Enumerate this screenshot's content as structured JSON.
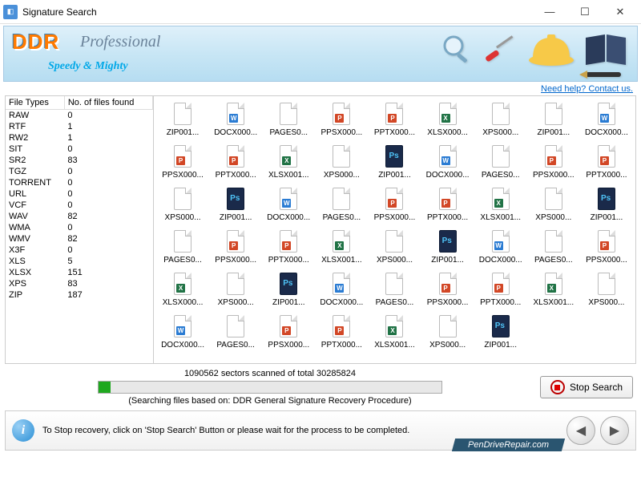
{
  "window": {
    "title": "Signature Search"
  },
  "banner": {
    "ddr": "DDR",
    "prof": "Professional",
    "tag": "Speedy & Mighty"
  },
  "help_link": "Need help? Contact us.",
  "table": {
    "col1": "File Types",
    "col2": "No. of files found",
    "rows": [
      {
        "t": "RAW",
        "n": "0"
      },
      {
        "t": "RTF",
        "n": "1"
      },
      {
        "t": "RW2",
        "n": "1"
      },
      {
        "t": "SIT",
        "n": "0"
      },
      {
        "t": "SR2",
        "n": "83"
      },
      {
        "t": "TGZ",
        "n": "0"
      },
      {
        "t": "TORRENT",
        "n": "0"
      },
      {
        "t": "URL",
        "n": "0"
      },
      {
        "t": "VCF",
        "n": "0"
      },
      {
        "t": "WAV",
        "n": "82"
      },
      {
        "t": "WMA",
        "n": "0"
      },
      {
        "t": "WMV",
        "n": "82"
      },
      {
        "t": "X3F",
        "n": "0"
      },
      {
        "t": "XLS",
        "n": "5"
      },
      {
        "t": "XLSX",
        "n": "151"
      },
      {
        "t": "XPS",
        "n": "83"
      },
      {
        "t": "ZIP",
        "n": "187"
      }
    ]
  },
  "files": [
    {
      "l": "ZIP001...",
      "k": "plain"
    },
    {
      "l": "DOCX000...",
      "k": "doc"
    },
    {
      "l": "PAGES0...",
      "k": "plain"
    },
    {
      "l": "PPSX000...",
      "k": "ppt"
    },
    {
      "l": "PPTX000...",
      "k": "ppt"
    },
    {
      "l": "XLSX000...",
      "k": "xls"
    },
    {
      "l": "XPS000...",
      "k": "plain"
    },
    {
      "l": "ZIP001...",
      "k": "plain"
    },
    {
      "l": "DOCX000...",
      "k": "doc"
    },
    {
      "l": "PPSX000...",
      "k": "ppt"
    },
    {
      "l": "PPTX000...",
      "k": "ppt"
    },
    {
      "l": "XLSX001...",
      "k": "xls"
    },
    {
      "l": "XPS000...",
      "k": "plain"
    },
    {
      "l": "ZIP001...",
      "k": "ps"
    },
    {
      "l": "DOCX000...",
      "k": "doc"
    },
    {
      "l": "PAGES0...",
      "k": "plain"
    },
    {
      "l": "PPSX000...",
      "k": "ppt"
    },
    {
      "l": "PPTX000...",
      "k": "ppt"
    },
    {
      "l": "XPS000...",
      "k": "plain"
    },
    {
      "l": "ZIP001...",
      "k": "ps"
    },
    {
      "l": "DOCX000...",
      "k": "doc"
    },
    {
      "l": "PAGES0...",
      "k": "plain"
    },
    {
      "l": "PPSX000...",
      "k": "ppt"
    },
    {
      "l": "PPTX000...",
      "k": "ppt"
    },
    {
      "l": "XLSX001...",
      "k": "xls"
    },
    {
      "l": "XPS000...",
      "k": "plain"
    },
    {
      "l": "ZIP001...",
      "k": "ps"
    },
    {
      "l": "PAGES0...",
      "k": "plain"
    },
    {
      "l": "PPSX000...",
      "k": "ppt"
    },
    {
      "l": "PPTX000...",
      "k": "ppt"
    },
    {
      "l": "XLSX001...",
      "k": "xls"
    },
    {
      "l": "XPS000...",
      "k": "plain"
    },
    {
      "l": "ZIP001...",
      "k": "ps"
    },
    {
      "l": "DOCX000...",
      "k": "doc"
    },
    {
      "l": "PAGES0...",
      "k": "plain"
    },
    {
      "l": "PPSX000...",
      "k": "ppt"
    },
    {
      "l": "XLSX000...",
      "k": "xls"
    },
    {
      "l": "XPS000...",
      "k": "plain"
    },
    {
      "l": "ZIP001...",
      "k": "ps"
    },
    {
      "l": "DOCX000...",
      "k": "doc"
    },
    {
      "l": "PAGES0...",
      "k": "plain"
    },
    {
      "l": "PPSX000...",
      "k": "ppt"
    },
    {
      "l": "PPTX000...",
      "k": "ppt"
    },
    {
      "l": "XLSX001...",
      "k": "xls"
    },
    {
      "l": "XPS000...",
      "k": "plain"
    },
    {
      "l": "DOCX000...",
      "k": "doc"
    },
    {
      "l": "PAGES0...",
      "k": "plain"
    },
    {
      "l": "PPSX000...",
      "k": "ppt"
    },
    {
      "l": "PPTX000...",
      "k": "ppt"
    },
    {
      "l": "XLSX001...",
      "k": "xls"
    },
    {
      "l": "XPS000...",
      "k": "plain"
    },
    {
      "l": "ZIP001...",
      "k": "ps"
    },
    {
      "l": "",
      "k": ""
    },
    {
      "l": "",
      "k": ""
    }
  ],
  "progress": {
    "sectors_text": "1090562 sectors scanned of total 30285824",
    "basis_text": "(Searching files based on:  DDR General Signature Recovery Procedure)",
    "stop_label": "Stop Search"
  },
  "footer": {
    "msg": "To Stop recovery, click on 'Stop Search' Button or please wait for the process to be completed.",
    "site": "PenDriveRepair.com"
  },
  "icon_colors": {
    "doc": "#2b7cd3",
    "ppt": "#d24726",
    "xls": "#217346",
    "ps": "#0a1e3a"
  }
}
